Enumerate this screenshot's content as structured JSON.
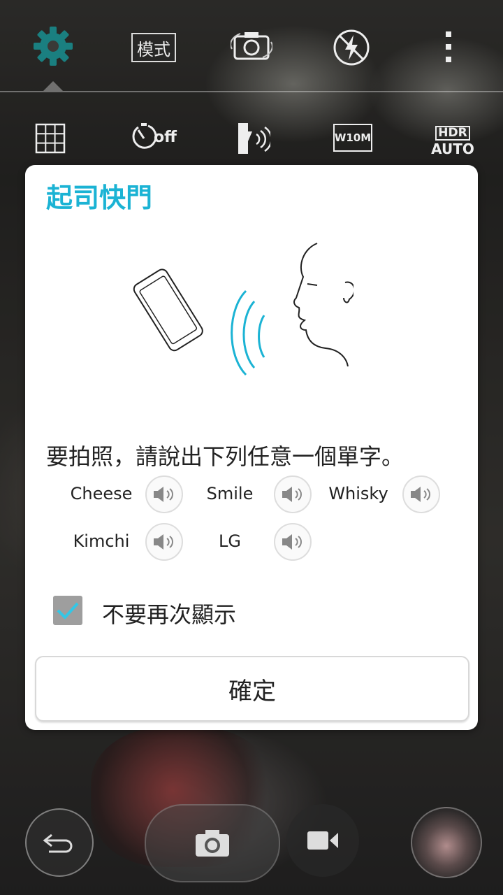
{
  "top_bar": {
    "mode_label": "模式",
    "icons": [
      "gear-icon",
      "mode-icon",
      "switch-camera-icon",
      "flash-auto-icon",
      "more-vert-icon"
    ]
  },
  "sub_bar": {
    "timer_label": "off",
    "resolution_label": "W10M",
    "hdr_label_top": "HDR",
    "hdr_label_bottom": "AUTO"
  },
  "dialog": {
    "title": "起司快門",
    "instruction": "要拍照，請說出下列任意一個單字。",
    "words": [
      "Cheese",
      "Smile",
      "Whisky",
      "Kimchi",
      "LG"
    ],
    "checkbox_label": "不要再次顯示",
    "checkbox_checked": true,
    "ok_label": "確定"
  },
  "colors": {
    "accent": "#1bb3d4",
    "check": "#33c7e6"
  }
}
